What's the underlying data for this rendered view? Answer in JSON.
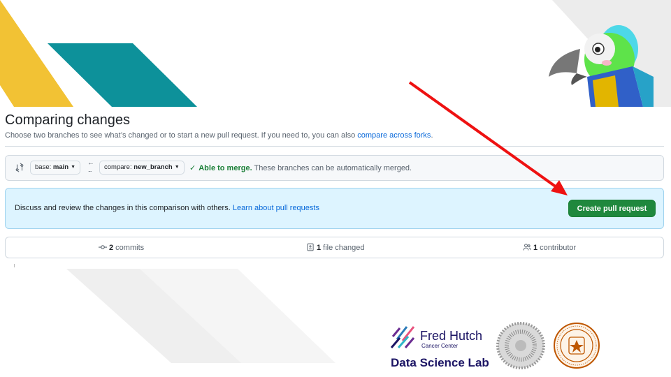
{
  "page": {
    "title": "Comparing changes",
    "subtitle": "Choose two branches to see what’s changed or to start a new pull request. If you need to, you can also ",
    "subtitle_link": "compare across forks",
    "subtitle_end": "."
  },
  "range": {
    "base_prefix": "base: ",
    "base_branch": "main",
    "compare_prefix": "compare: ",
    "compare_branch": "new_branch",
    "merge_ok": "Able to merge.",
    "merge_text": " These branches can be automatically merged."
  },
  "flash": {
    "text": "Discuss and review the changes in this comparison with others. ",
    "link": "Learn about pull requests",
    "button": "Create pull request"
  },
  "summary": {
    "commits_count": "2",
    "commits_label": " commits",
    "files_count": "1",
    "files_label": " file changed",
    "contributors_count": "1",
    "contributors_label": " contributor"
  },
  "branding": {
    "org_name": "Fred Hutch",
    "org_sub": "Cancer Center",
    "lab_name": "Data Science Lab"
  },
  "colors": {
    "accent_yellow": "#f2c234",
    "accent_teal": "#0d919a",
    "success_green": "#1f883d",
    "annotation_red": "#ee1111"
  }
}
